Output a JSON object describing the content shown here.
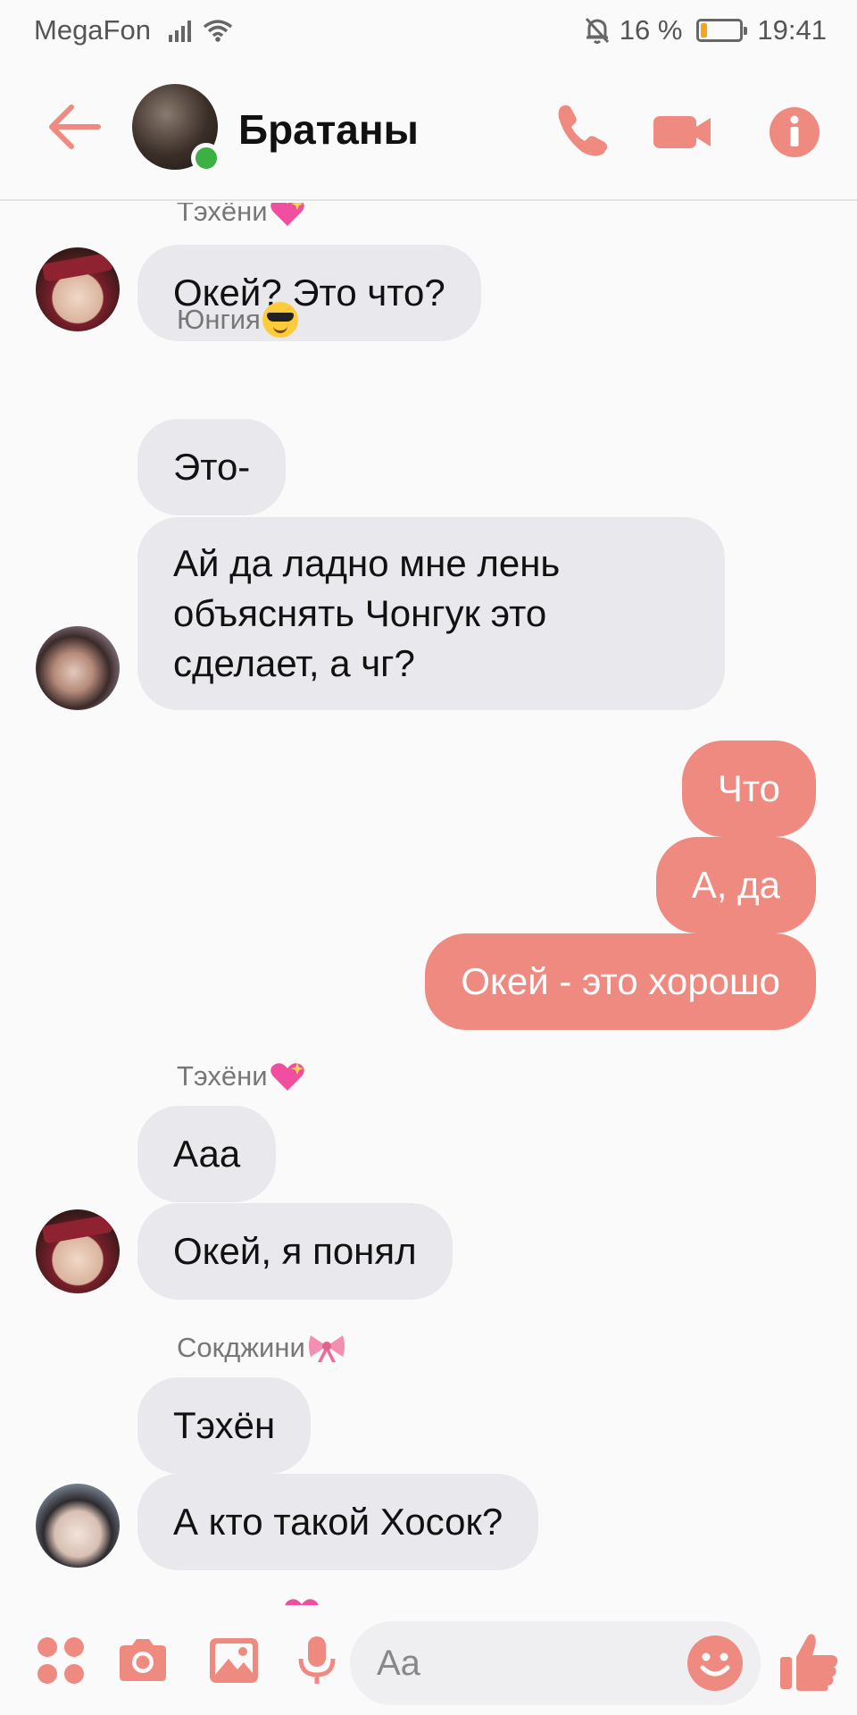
{
  "status_bar": {
    "carrier": "MegaFon",
    "battery_text": "16 %",
    "battery_level": 0.16,
    "time": "19:41"
  },
  "header": {
    "title": "Братаны",
    "online": true
  },
  "accent_color": "#ef8a80",
  "messages": [
    {
      "sender": "Тэхёни",
      "sender_emoji": "sparkling-heart",
      "direction": "in",
      "text": "Окей? Это что?"
    },
    {
      "sender": "Юнгия",
      "sender_emoji": "sunglasses-face",
      "direction": "in",
      "text": "Это-"
    },
    {
      "direction": "in",
      "text_lines": [
        "Ай да ладно мне лень",
        "объяснять Чонгук это",
        "сделает, а чг?"
      ]
    },
    {
      "direction": "out",
      "text": "Что"
    },
    {
      "direction": "out",
      "text": "А, да"
    },
    {
      "direction": "out",
      "text": "Окей - это хорошо"
    },
    {
      "sender": "Тэхёни",
      "sender_emoji": "sparkling-heart",
      "direction": "in",
      "text": "Ааа"
    },
    {
      "direction": "in",
      "text": "Окей, я понял"
    },
    {
      "sender": "Сокджини",
      "sender_emoji": "ribbon",
      "direction": "in",
      "text": "Тэхён"
    },
    {
      "direction": "in",
      "text": "А кто такой Хосок?"
    }
  ],
  "composer": {
    "placeholder": "Aa",
    "value": ""
  }
}
